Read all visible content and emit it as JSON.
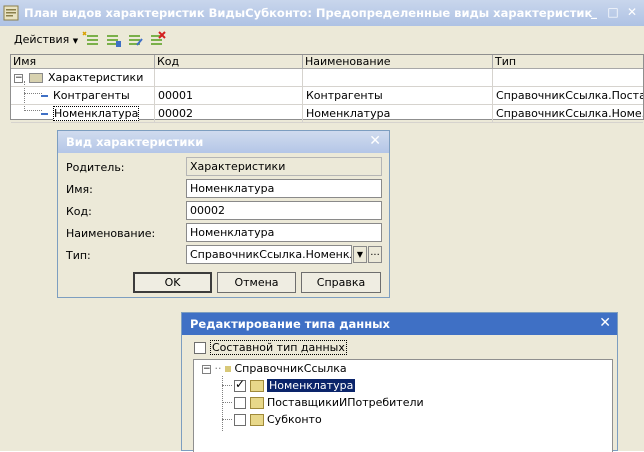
{
  "main_window": {
    "title": "План видов характеристик ВидыСубконто: Предопределенные виды характеристик",
    "actions_label": "Действия",
    "columns": [
      "Имя",
      "Код",
      "Наименование",
      "Тип"
    ],
    "root": {
      "name": "Характеристики"
    },
    "rows": [
      {
        "name": "Контрагенты",
        "code": "00001",
        "title": "Контрагенты",
        "type": "СправочникСсылка.Поста..."
      },
      {
        "name": "Номенклатура",
        "code": "00002",
        "title": "Номенклатура",
        "type": "СправочникСсылка.Номе..."
      }
    ]
  },
  "dialog_characteristic": {
    "title": "Вид характеристики",
    "fields": {
      "parent_label": "Родитель:",
      "parent_value": "Характеристики",
      "name_label": "Имя:",
      "name_value": "Номенклатура",
      "code_label": "Код:",
      "code_value": "00002",
      "title_label": "Наименование:",
      "title_value": "Номенклатура",
      "type_label": "Тип:",
      "type_value": "СправочникСсылка.Номенклату",
      "type_more": "..."
    },
    "buttons": {
      "ok": "OK",
      "cancel": "Отмена",
      "help": "Справка"
    }
  },
  "dialog_type": {
    "title": "Редактирование типа данных",
    "composite_label": "Составной тип данных",
    "composite_checked": false,
    "tree_root": "СправочникСсылка",
    "items": [
      {
        "label": "Номенклатура",
        "checked": true,
        "selected": true
      },
      {
        "label": "ПоставщикиИПотребители",
        "checked": false,
        "selected": false
      },
      {
        "label": "Субконто",
        "checked": false,
        "selected": false
      }
    ]
  },
  "colors": {
    "title_active": "#3f70c5",
    "title_inactive": "#b4c6e7",
    "selection": "#0a246a"
  }
}
